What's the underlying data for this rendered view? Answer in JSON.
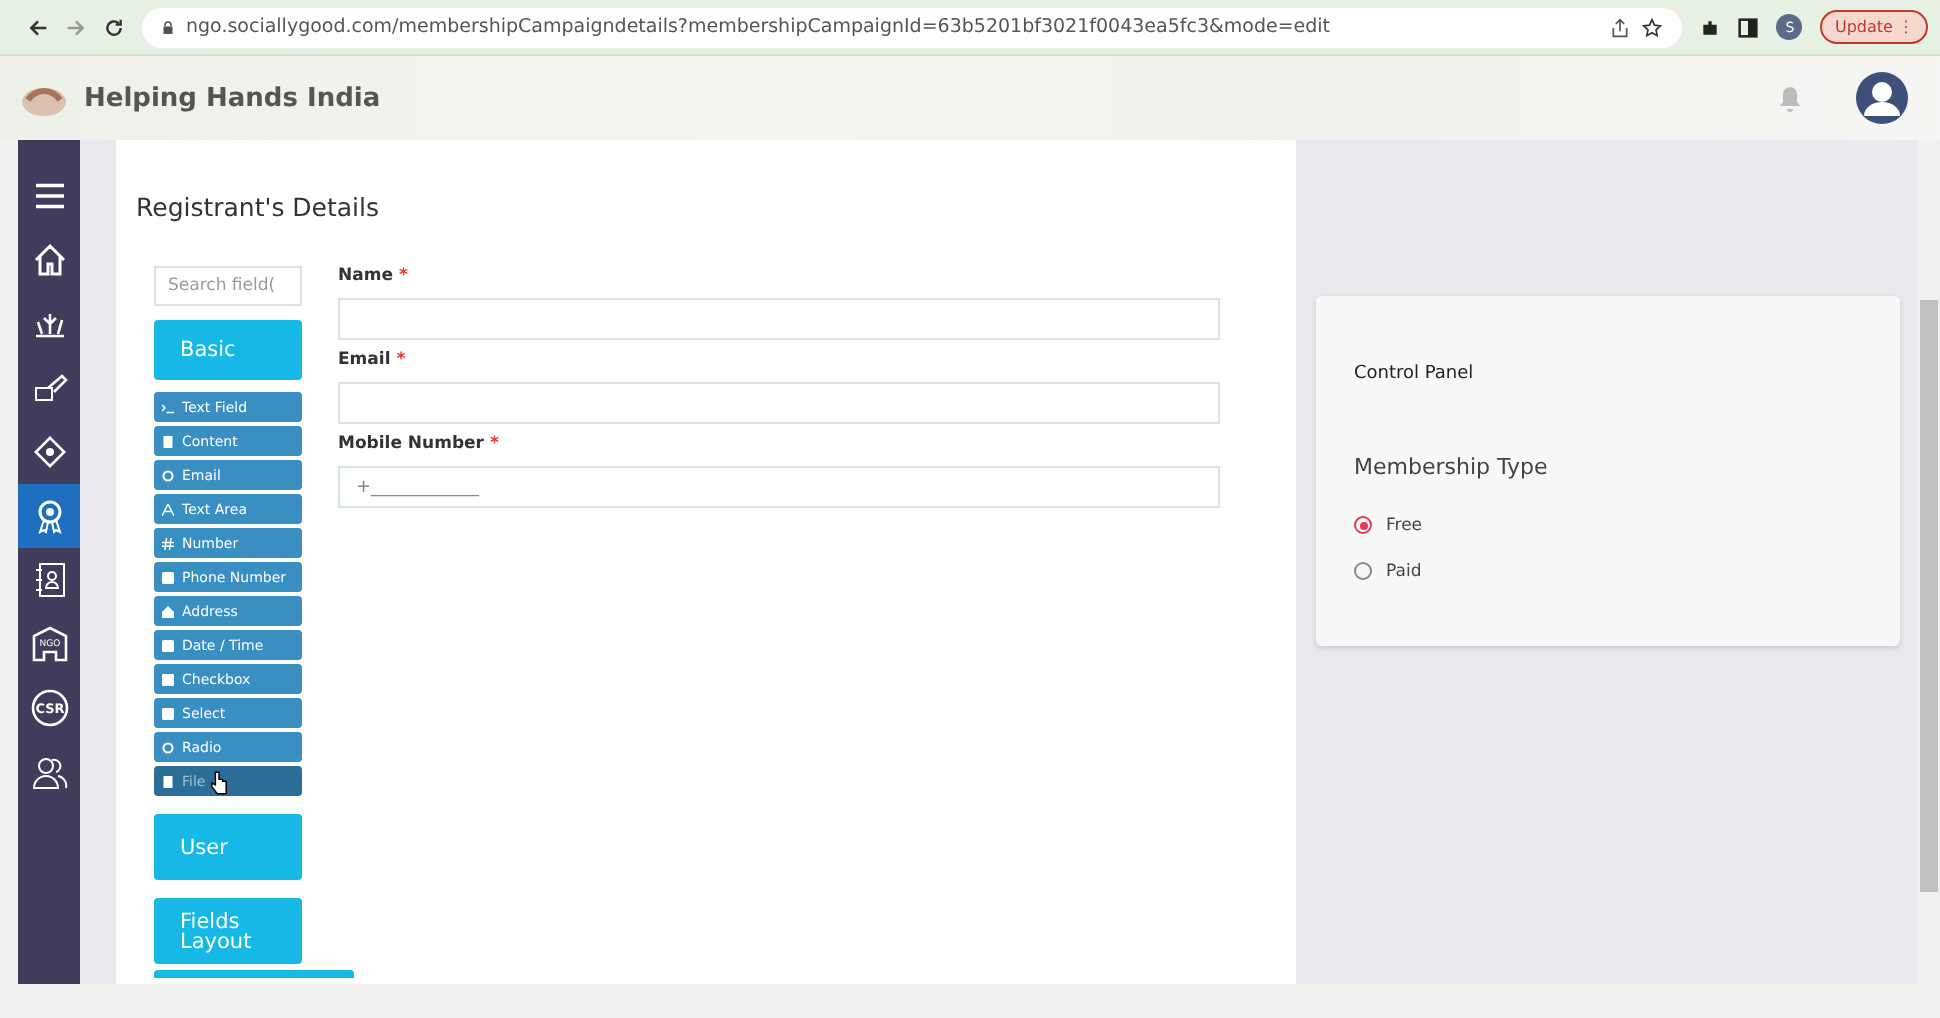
{
  "browser": {
    "url": "ngo.sociallygood.com/membershipCampaigndetails?membershipCampaignId=63b5201bf3021f0043ea5fc3&mode=edit",
    "profile_initial": "S",
    "update_label": "Update",
    "update_glyph": "⋮"
  },
  "header": {
    "org_name": "Helping Hands India"
  },
  "sidebar": {
    "items": [
      {
        "selected": false
      },
      {
        "selected": false
      },
      {
        "selected": false
      },
      {
        "selected": false
      },
      {
        "selected": false
      },
      {
        "selected": true
      },
      {
        "selected": false
      },
      {
        "selected": false,
        "label": "NGO"
      },
      {
        "selected": false,
        "label": "CSR"
      },
      {
        "selected": false
      }
    ]
  },
  "form": {
    "title": "Registrant's Details",
    "search": {
      "placeholder": "Search field("
    },
    "groups": [
      {
        "label": "Basic"
      }
    ],
    "field_types": [
      {
        "label": "Text Field",
        "dragging": false
      },
      {
        "label": "Content",
        "dragging": false
      },
      {
        "label": "Email",
        "dragging": false
      },
      {
        "label": "Text Area",
        "dragging": false
      },
      {
        "label": "Number",
        "dragging": false
      },
      {
        "label": "Phone Number",
        "dragging": false
      },
      {
        "label": "Address",
        "dragging": false
      },
      {
        "label": "Date / Time",
        "dragging": false
      },
      {
        "label": "Checkbox",
        "dragging": false
      },
      {
        "label": "Select",
        "dragging": false
      },
      {
        "label": "Radio",
        "dragging": false
      },
      {
        "label": "File",
        "dragging": true
      }
    ],
    "more_groups": [
      {
        "label": "User"
      },
      {
        "label": "Fields Layout"
      }
    ],
    "fields": [
      {
        "label": "Name",
        "required_mark": "*"
      },
      {
        "label": "Email",
        "required_mark": "*"
      },
      {
        "label": "Mobile Number",
        "required_mark": "*",
        "placeholder": "+____________"
      }
    ]
  },
  "control_panel": {
    "title": "Control Panel",
    "section": "Membership Type",
    "options": [
      {
        "label": "Free",
        "selected": true
      },
      {
        "label": "Paid",
        "selected": false
      }
    ]
  }
}
